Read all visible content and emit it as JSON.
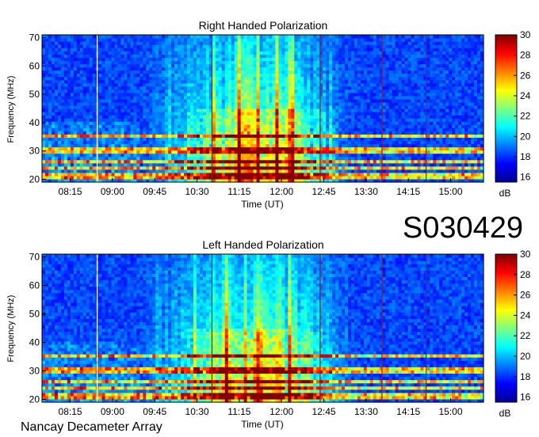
{
  "figure": {
    "observation_id": "S030429",
    "instrument": "Nancay Decameter Array"
  },
  "chart_data": [
    {
      "type": "heatmap",
      "title": "Right Handed Polarization",
      "xlabel": "Time (UT)",
      "ylabel": "Frequency (MHz)",
      "x_tick_labels": [
        "08:15",
        "09:00",
        "09:45",
        "10:30",
        "11:15",
        "12:00",
        "12:45",
        "13:30",
        "14:15",
        "15:00"
      ],
      "x_range": [
        "07:45",
        "15:35"
      ],
      "y_ticks": [
        20,
        30,
        40,
        50,
        60,
        70
      ],
      "ylim": [
        19,
        71
      ],
      "colorbar": {
        "unit": "dB",
        "range": [
          15.5,
          30
        ],
        "ticks": [
          16,
          18,
          20,
          22,
          24,
          26,
          28,
          30
        ],
        "colormap": "jet"
      },
      "activity": {
        "main_burst_start": "10:20",
        "main_burst_peak": "11:40",
        "main_burst_end": "13:05",
        "peak_db": 29,
        "background_db": 17.5
      },
      "interference_bands_mhz": [
        21,
        24,
        26.5,
        30,
        35.5
      ]
    },
    {
      "type": "heatmap",
      "title": "Left Handed Polarization",
      "xlabel": "Time (UT)",
      "ylabel": "Frequency (MHz)",
      "x_tick_labels": [
        "08:15",
        "09:00",
        "09:45",
        "10:30",
        "11:15",
        "12:00",
        "12:45",
        "13:30",
        "14:15",
        "15:00"
      ],
      "x_range": [
        "07:45",
        "15:35"
      ],
      "y_ticks": [
        20,
        30,
        40,
        50,
        60,
        70
      ],
      "ylim": [
        19,
        71
      ],
      "colorbar": {
        "unit": "dB",
        "range": [
          15.5,
          30
        ],
        "ticks": [
          16,
          18,
          20,
          22,
          24,
          26,
          28,
          30
        ],
        "colormap": "jet"
      },
      "activity": {
        "main_burst_start": "10:20",
        "main_burst_peak": "11:35",
        "main_burst_end": "13:05",
        "peak_db": 29.5,
        "background_db": 17.5
      },
      "interference_bands_mhz": [
        21,
        24,
        26.5,
        30,
        35.5
      ]
    }
  ]
}
